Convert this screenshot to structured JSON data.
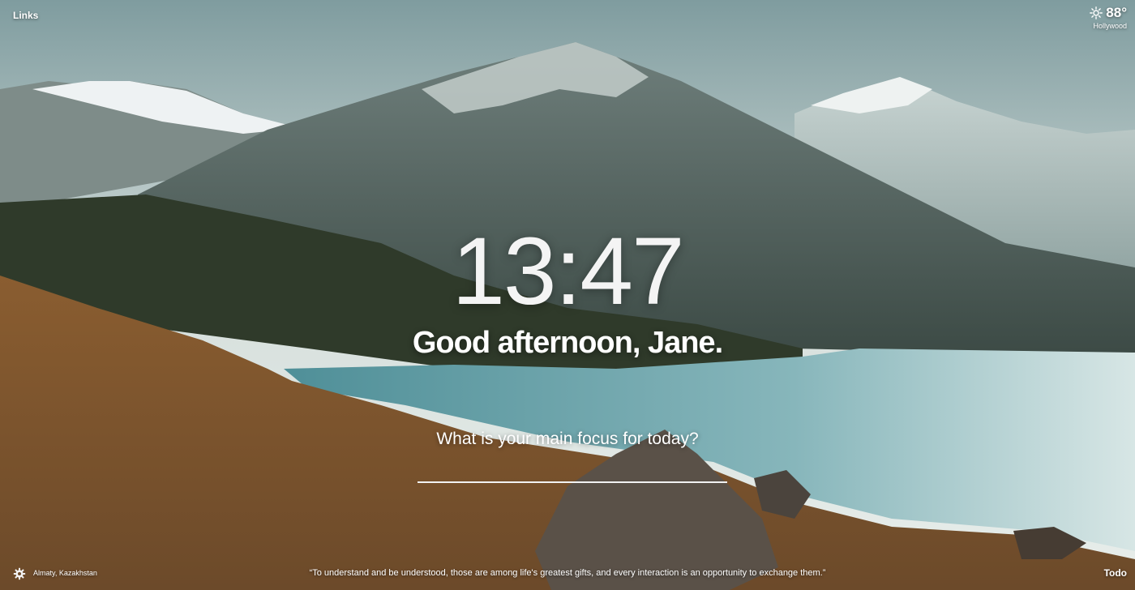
{
  "header": {
    "links_label": "Links"
  },
  "weather": {
    "icon": "sun-icon",
    "temperature": "88°",
    "location": "Hollywood"
  },
  "clock": {
    "time": "13:47"
  },
  "greeting": {
    "text": "Good afternoon, Jane."
  },
  "focus": {
    "prompt": "What is your main focus for today?",
    "value": "",
    "placeholder": ""
  },
  "footer": {
    "settings_icon": "gear-icon",
    "photo_location": "Almaty, Kazakhstan",
    "quote": "“To understand and be understood, those are among life's greatest gifts, and every interaction is an opportunity to exchange them.”",
    "todo_label": "Todo"
  },
  "colors": {
    "sky": "#c9d6d4",
    "mountain": "#4f605e",
    "snow": "#dfe7e6",
    "lake": "#7fb0b6",
    "hillside": "#9b6a37",
    "text": "#ffffff"
  }
}
